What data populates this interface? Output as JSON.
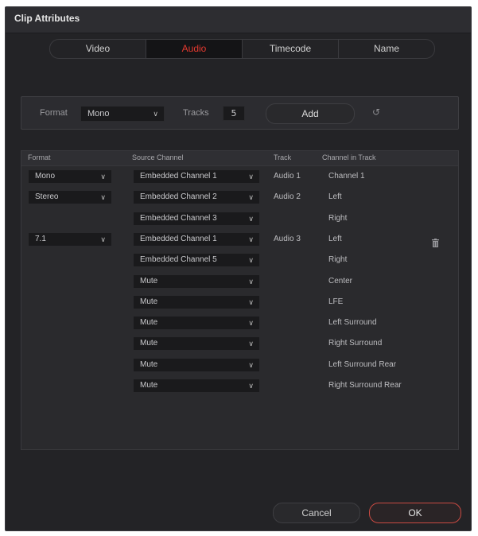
{
  "window": {
    "title": "Clip Attributes"
  },
  "tabs": [
    {
      "label": "Video",
      "active": false
    },
    {
      "label": "Audio",
      "active": true
    },
    {
      "label": "Timecode",
      "active": false
    },
    {
      "label": "Name",
      "active": false
    }
  ],
  "add_bar": {
    "format_label": "Format",
    "format_value": "Mono",
    "tracks_label": "Tracks",
    "tracks_value": "5",
    "add_label": "Add",
    "reset_icon": "reset-icon"
  },
  "grid": {
    "headers": {
      "format": "Format",
      "source_channel": "Source Channel",
      "track": "Track",
      "channel_in_track": "Channel in Track"
    },
    "rows": [
      {
        "format": "Mono",
        "source": "Embedded Channel 1",
        "track": "Audio 1",
        "channel": "Channel 1"
      },
      {
        "format": "Stereo",
        "source": "Embedded Channel 2",
        "track": "Audio 2",
        "channel": "Left"
      },
      {
        "format": "",
        "source": "Embedded Channel 3",
        "track": "",
        "channel": "Right"
      },
      {
        "format": "7.1",
        "source": "Embedded Channel 1",
        "track": "Audio 3",
        "channel": "Left"
      },
      {
        "format": "",
        "source": "Embedded Channel 5",
        "track": "",
        "channel": "Right"
      },
      {
        "format": "",
        "source": "Mute",
        "track": "",
        "channel": "Center"
      },
      {
        "format": "",
        "source": "Mute",
        "track": "",
        "channel": "LFE"
      },
      {
        "format": "",
        "source": "Mute",
        "track": "",
        "channel": "Left Surround"
      },
      {
        "format": "",
        "source": "Mute",
        "track": "",
        "channel": "Right Surround"
      },
      {
        "format": "",
        "source": "Mute",
        "track": "",
        "channel": "Left Surround Rear"
      },
      {
        "format": "",
        "source": "Mute",
        "track": "",
        "channel": "Right Surround Rear"
      }
    ],
    "delete_icon": "trash-icon"
  },
  "footer": {
    "cancel_label": "Cancel",
    "ok_label": "OK"
  },
  "colors": {
    "accent": "#e4392f",
    "background": "#232326",
    "field": "#1a1a1c"
  }
}
